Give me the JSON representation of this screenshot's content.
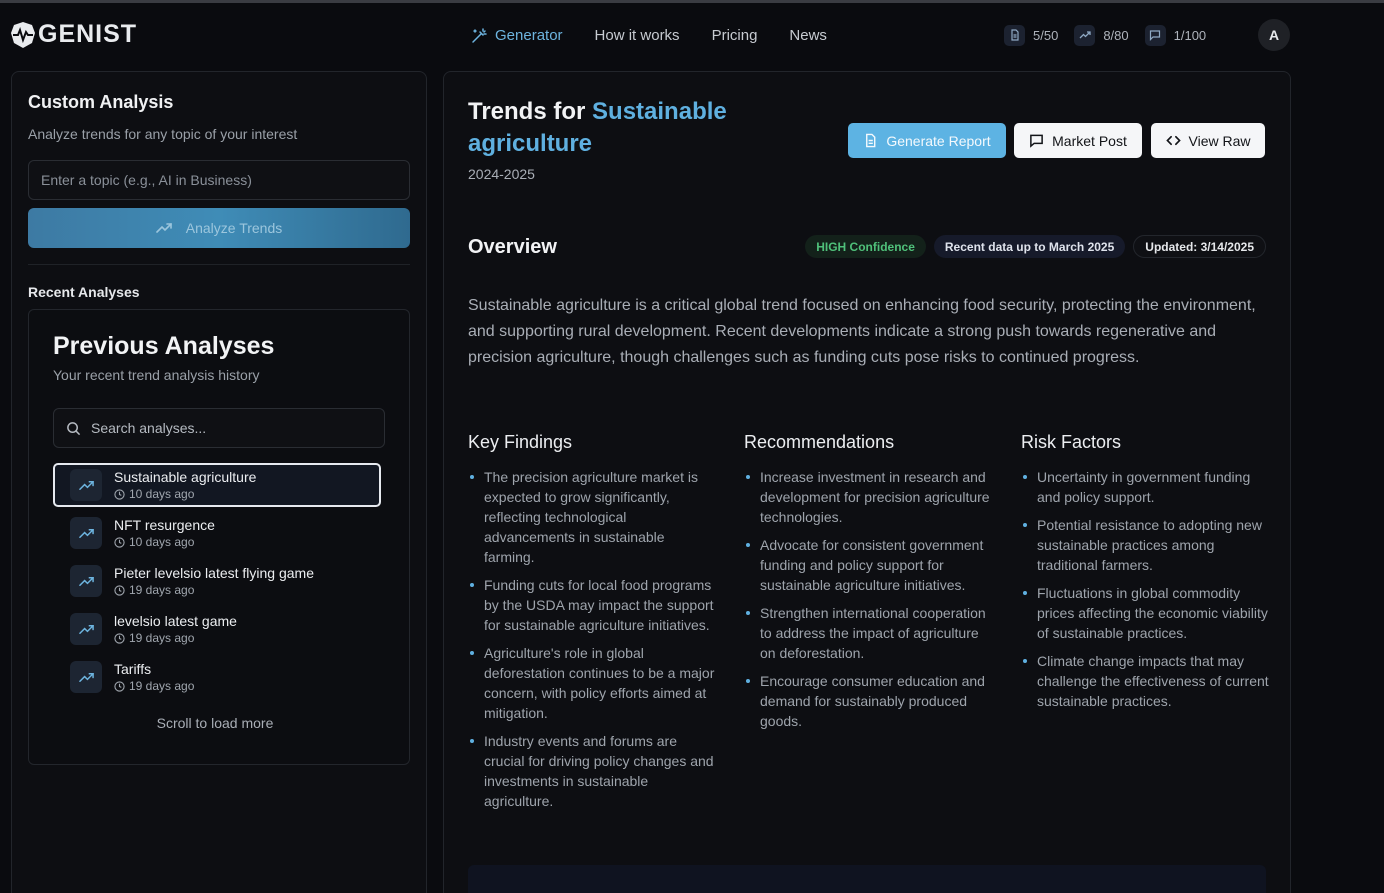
{
  "app": {
    "logo_text": "GENIST",
    "accent_color": "#5fb0e0"
  },
  "nav": {
    "items": [
      {
        "label": "Generator",
        "icon": "wand-icon",
        "active": true
      },
      {
        "label": "How it works"
      },
      {
        "label": "Pricing"
      },
      {
        "label": "News"
      }
    ]
  },
  "usage": {
    "reports": "5/50",
    "trends": "8/80",
    "posts": "1/100"
  },
  "user": {
    "avatar_initial": "A"
  },
  "sidebar": {
    "title": "Custom Analysis",
    "subtitle": "Analyze trends for any topic of your interest",
    "topic_placeholder": "Enter a topic (e.g., AI in Business)",
    "topic_value": "",
    "analyze_label": "Analyze Trends",
    "recent_label": "Recent Analyses",
    "history": {
      "title": "Previous Analyses",
      "subtitle": "Your recent trend analysis history",
      "search_placeholder": "Search analyses...",
      "items": [
        {
          "name": "Sustainable agriculture",
          "time": "10 days ago",
          "selected": true
        },
        {
          "name": "NFT resurgence",
          "time": "10 days ago"
        },
        {
          "name": "Pieter levelsio latest flying game",
          "time": "19 days ago"
        },
        {
          "name": "levelsio latest game",
          "time": "19 days ago"
        },
        {
          "name": "Tariffs",
          "time": "19 days ago"
        }
      ],
      "load_more": "Scroll to load more"
    }
  },
  "main": {
    "title_prefix": "Trends for",
    "title_topic": "Sustainable agriculture",
    "years": "2024-2025",
    "buttons": {
      "report": "Generate Report",
      "market": "Market Post",
      "raw": "View Raw"
    },
    "overview": {
      "heading": "Overview",
      "badge_confidence": "HIGH Confidence",
      "badge_recent": "Recent data up to March 2025",
      "badge_updated": "Updated: 3/14/2025",
      "summary": "Sustainable agriculture is a critical global trend focused on enhancing food security, protecting the environment, and supporting rural development. Recent developments indicate a strong push towards regenerative and precision agriculture, though challenges such as funding cuts pose risks to continued progress."
    },
    "key_findings": {
      "heading": "Key Findings",
      "items": [
        "The precision agriculture market is expected to grow significantly, reflecting technological advancements in sustainable farming.",
        "Funding cuts for local food programs by the USDA may impact the support for sustainable agriculture initiatives.",
        "Agriculture's role in global deforestation continues to be a major concern, with policy efforts aimed at mitigation.",
        "Industry events and forums are crucial for driving policy changes and investments in sustainable agriculture."
      ]
    },
    "recommendations": {
      "heading": "Recommendations",
      "items": [
        "Increase investment in research and development for precision agriculture technologies.",
        "Advocate for consistent government funding and policy support for sustainable agriculture initiatives.",
        "Strengthen international cooperation to address the impact of agriculture on deforestation.",
        "Encourage consumer education and demand for sustainably produced goods."
      ]
    },
    "risk_factors": {
      "heading": "Risk Factors",
      "items": [
        "Uncertainty in government funding and policy support.",
        "Potential resistance to adopting new sustainable practices among traditional farmers.",
        "Fluctuations in global commodity prices affecting the economic viability of sustainable practices.",
        "Climate change impacts that may challenge the effectiveness of current sustainable practices."
      ]
    }
  }
}
